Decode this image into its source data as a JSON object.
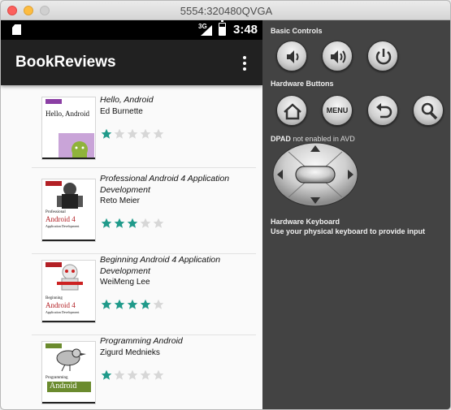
{
  "window": {
    "title": "5554:320480QVGA"
  },
  "status_bar": {
    "network": "3G",
    "time": "3:48"
  },
  "app_bar": {
    "title": "BookReviews",
    "menu_icon": "overflow-menu-icon"
  },
  "books": [
    {
      "title": "Hello, Android",
      "author": "Ed Burnette",
      "rating": 1,
      "max_rating": 5,
      "cover": {
        "bg": "#ffffff",
        "accent": "#8b3fa4",
        "title_lines": [
          "Hello, Android"
        ],
        "figure": "android-robot"
      }
    },
    {
      "title": "Professional Android 4 Application Development",
      "author": "Reto Meier",
      "rating": 3,
      "max_rating": 5,
      "cover": {
        "bg": "#ffffff",
        "accent": "#b32025",
        "title_lines": [
          "Professional",
          "Android 4",
          "Application Development"
        ],
        "figure": "robot-hand"
      }
    },
    {
      "title": "Beginning Android 4 Application Development",
      "author": "WeiMeng Lee",
      "rating": 4,
      "max_rating": 5,
      "cover": {
        "bg": "#ffffff",
        "accent": "#b32025",
        "title_lines": [
          "Beginning",
          "Android 4",
          "Application Development"
        ],
        "figure": "robot-droid"
      }
    },
    {
      "title": "Programming Android",
      "author": "Zigurd Mednieks",
      "rating": 1,
      "max_rating": 5,
      "cover": {
        "bg": "#ffffff",
        "accent": "#6b8b2e",
        "title_lines": [
          "Programming",
          "Android"
        ],
        "figure": "bird"
      }
    }
  ],
  "controls": {
    "basic_label": "Basic Controls",
    "hardware_label": "Hardware Buttons",
    "menu_label": "MENU",
    "dpad_prefix": "DPAD",
    "dpad_status": "not enabled in AVD",
    "keyboard_title": "Hardware Keyboard",
    "keyboard_hint": "Use your physical keyboard to provide input"
  },
  "colors": {
    "star_on": "#1f9a8a",
    "star_off": "#d7d7d7",
    "app_bar": "#212121",
    "panel": "#434343"
  }
}
